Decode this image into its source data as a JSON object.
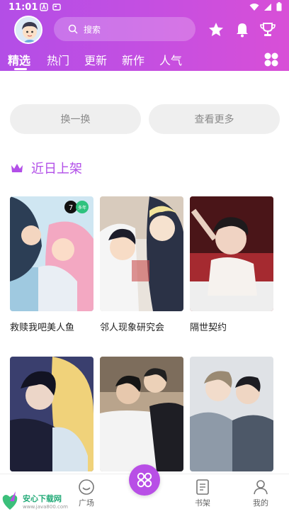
{
  "status": {
    "time": "11:01"
  },
  "search": {
    "placeholder": "搜索"
  },
  "tabs": [
    "精选",
    "热门",
    "更新",
    "新作",
    "人气"
  ],
  "buttons": {
    "shuffle": "换一换",
    "more": "查看更多"
  },
  "section": {
    "title": "近日上架"
  },
  "comics": [
    {
      "title": "救赎我吧美人鱼"
    },
    {
      "title": "邻人现象研究会"
    },
    {
      "title": "隔世契约"
    },
    {
      "title": ""
    },
    {
      "title": ""
    },
    {
      "title": ""
    }
  ],
  "badge": {
    "left": "7",
    "right": "多年"
  },
  "bottom_nav": {
    "plaza": "广场",
    "shelf": "书架",
    "mine": "我的"
  },
  "watermark": {
    "brand": "安心下载网",
    "url": "www.java800.com"
  },
  "colors": {
    "accent": "#b24fe8",
    "header_start": "#b34ee6",
    "header_end": "#d84fd7"
  },
  "icons": [
    "search-icon",
    "star-icon",
    "bell-icon",
    "trophy-icon",
    "grid-icon",
    "crown-icon",
    "smile-icon",
    "book-icon",
    "person-icon"
  ]
}
